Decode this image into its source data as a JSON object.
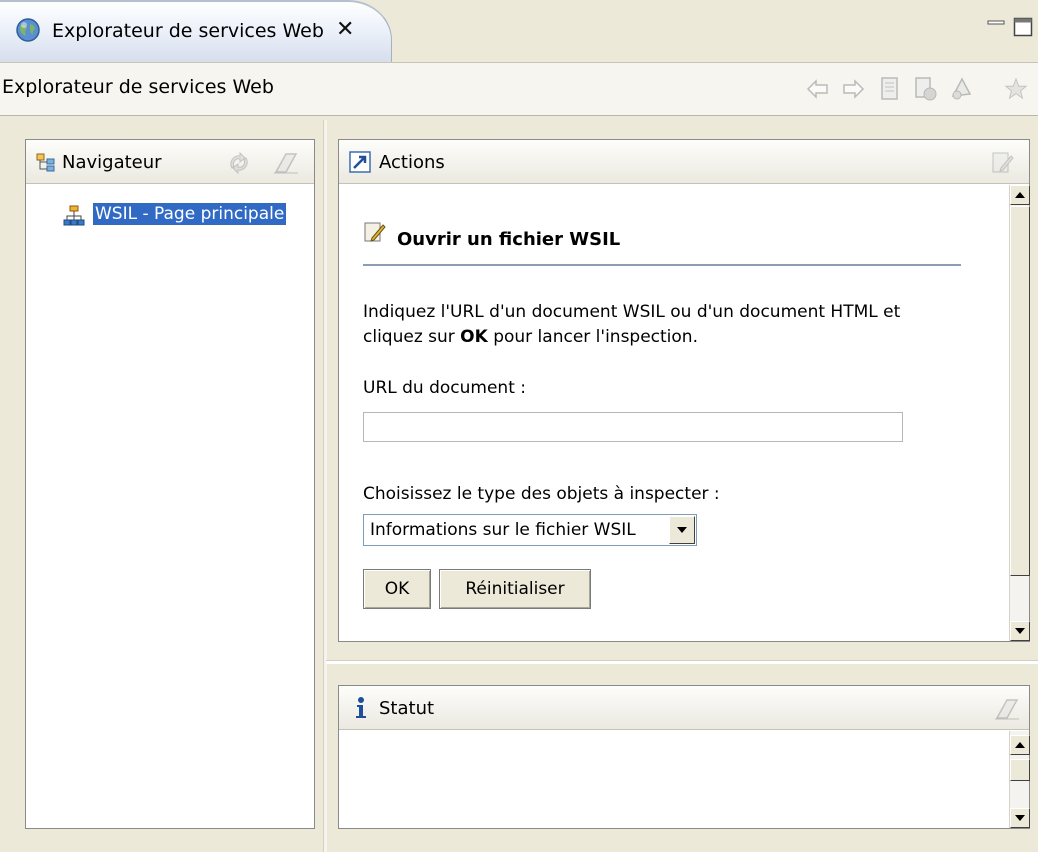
{
  "tab": {
    "title": "Explorateur de services Web",
    "close_glyph": "✕",
    "icon": "globe-icon"
  },
  "toolbar": {
    "title": "Explorateur de services Web",
    "icons": [
      "back-arrow-icon",
      "forward-arrow-icon",
      "document-icon",
      "favorites-document-icon",
      "wsdl-icon",
      "star-icon"
    ]
  },
  "navigator": {
    "title": "Navigateur",
    "tree": [
      {
        "label": "WSIL - Page principale",
        "selected": true,
        "icon": "hierarchy-icon"
      }
    ]
  },
  "actions": {
    "title": "Actions",
    "form": {
      "heading": "Ouvrir un fichier WSIL",
      "intro_line1": "Indiquez l'URL d'un document WSIL ou d'un document HTML et",
      "intro_line2_pre": "cliquez sur ",
      "intro_line2_bold": "OK",
      "intro_line2_post": " pour lancer l'inspection.",
      "url_label": "URL du document :",
      "url_value": "",
      "type_label": "Choisissez le type des objets à inspecter :",
      "type_selected": "Informations sur le fichier WSIL",
      "ok_label": "OK",
      "reset_label": "Réinitialiser"
    }
  },
  "status": {
    "title": "Statut",
    "icon": "info-icon"
  },
  "colors": {
    "selection": "#316ac5",
    "rule": "#8c9db5",
    "background": "#ece9d8"
  }
}
